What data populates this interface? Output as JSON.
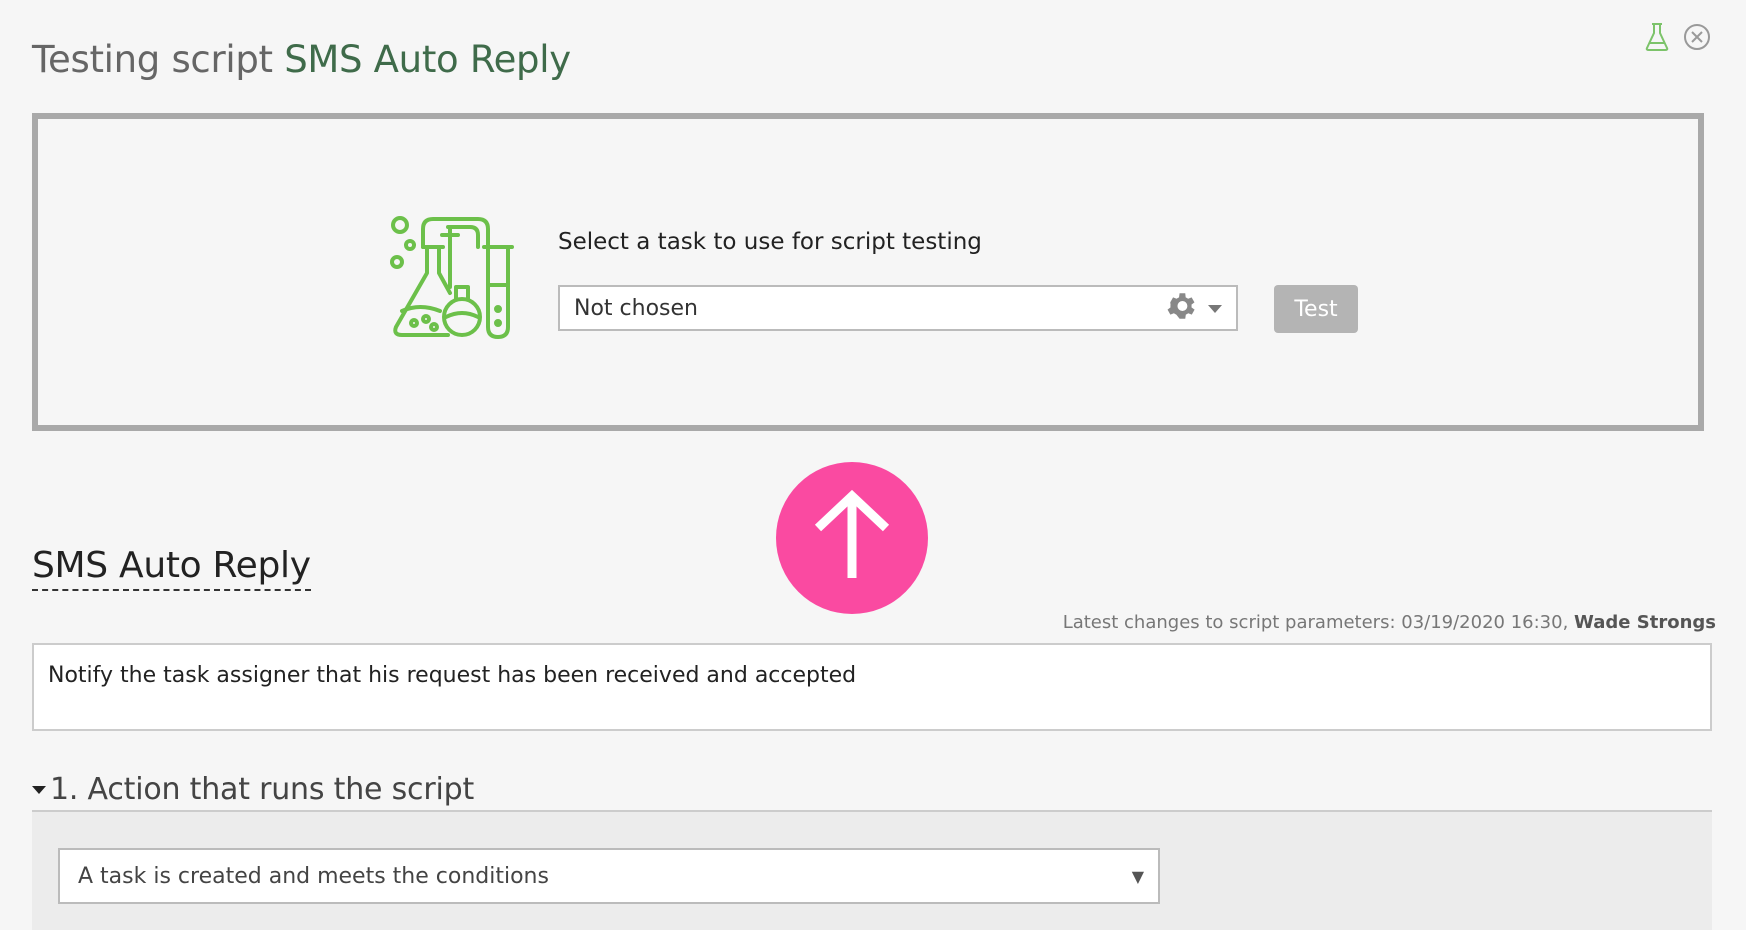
{
  "header": {
    "title_prefix": "Testing script",
    "script_name": "SMS Auto Reply",
    "icons": [
      "flask-icon",
      "close-circle-icon"
    ]
  },
  "test_panel": {
    "label": "Select a task to use for script testing",
    "task_select_value": "Not chosen",
    "test_button_label": "Test",
    "icons": [
      "lab-equipment-icon",
      "gear-icon",
      "caret-down-icon"
    ]
  },
  "scroll_up": {
    "icon": "arrow-up-icon"
  },
  "script": {
    "name": "SMS Auto Reply",
    "latest_changes_label": "Latest changes to script parameters: 03/19/2020 16:30,",
    "latest_changes_user": "Wade Strongs",
    "description": "Notify the task assigner that his request has been received and accepted"
  },
  "section_1": {
    "title": "1. Action that runs the script",
    "action_value": "A task is created and meets the conditions",
    "action_caret": "▼"
  },
  "colors": {
    "accent_green": "#6cc04a",
    "title_green": "#3f6b4a",
    "pink_button": "#fa4aa1",
    "disabled_button": "#b4b4b4"
  }
}
